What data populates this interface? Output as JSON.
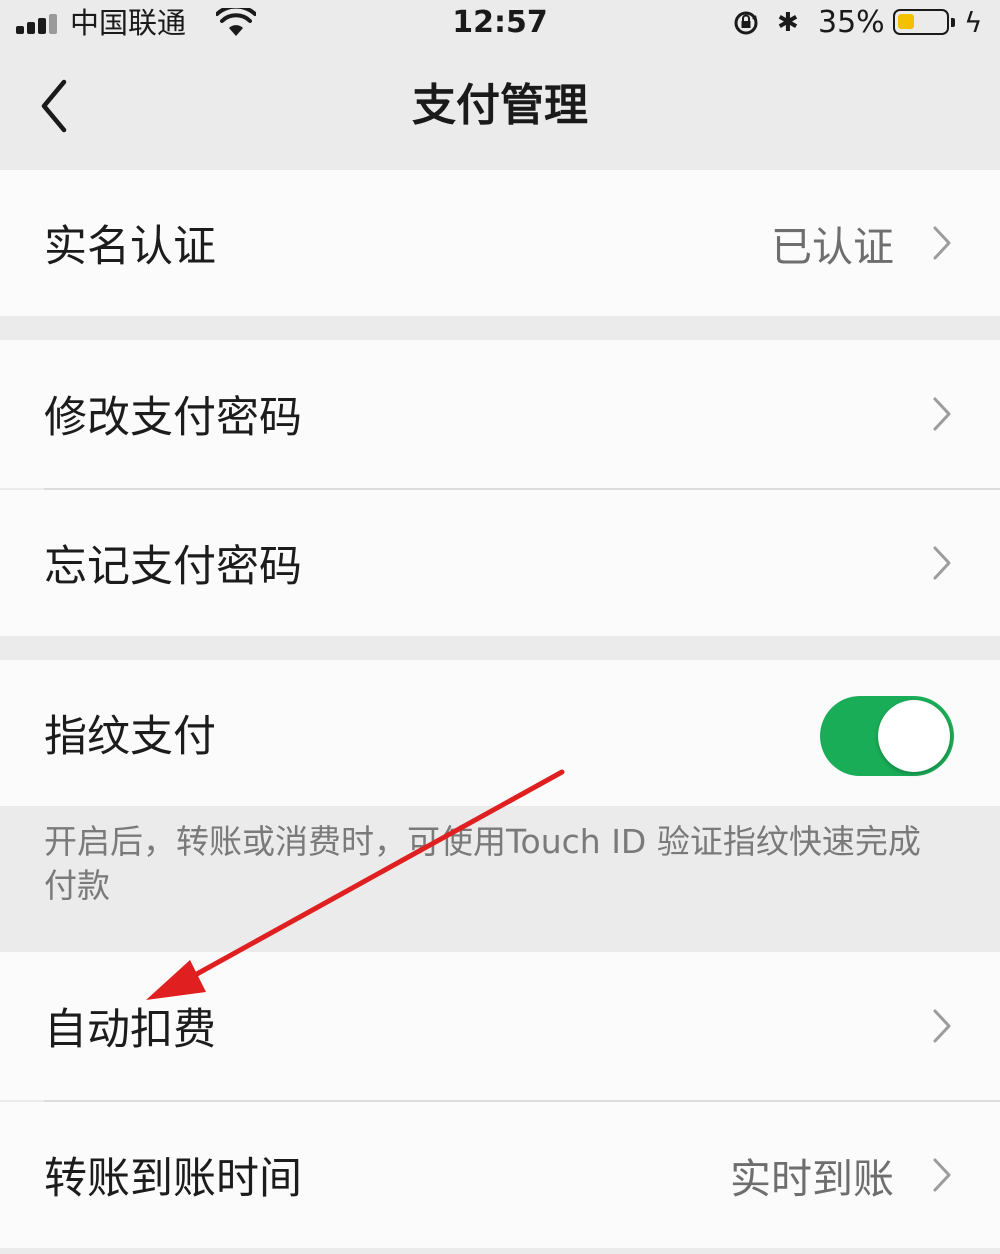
{
  "status_bar": {
    "carrier": "中国联通",
    "time": "12:57",
    "battery_percent": "35%",
    "battery_level": 0.35,
    "battery_color": "#f4c000",
    "icons": [
      "signal-bars-icon",
      "wifi-icon",
      "rotation-lock-icon",
      "bluetooth-icon",
      "battery-icon",
      "charging-bolt-icon"
    ]
  },
  "nav": {
    "title": "支付管理",
    "back_icon": "chevron-left-icon"
  },
  "settings": {
    "real_name": {
      "label": "实名认证",
      "value": "已认证"
    },
    "change_password": {
      "label": "修改支付密码"
    },
    "forgot_password": {
      "label": "忘记支付密码"
    },
    "fingerprint": {
      "label": "指纹支付",
      "enabled": true,
      "description": "开启后，转账或消费时，可使用Touch ID 验证指纹快速完成付款"
    },
    "auto_deduct": {
      "label": "自动扣费"
    },
    "transfer_time": {
      "label": "转账到账时间",
      "value": "实时到账"
    }
  },
  "colors": {
    "toggle_on": "#1aad57",
    "annotation_arrow": "#e02020"
  }
}
